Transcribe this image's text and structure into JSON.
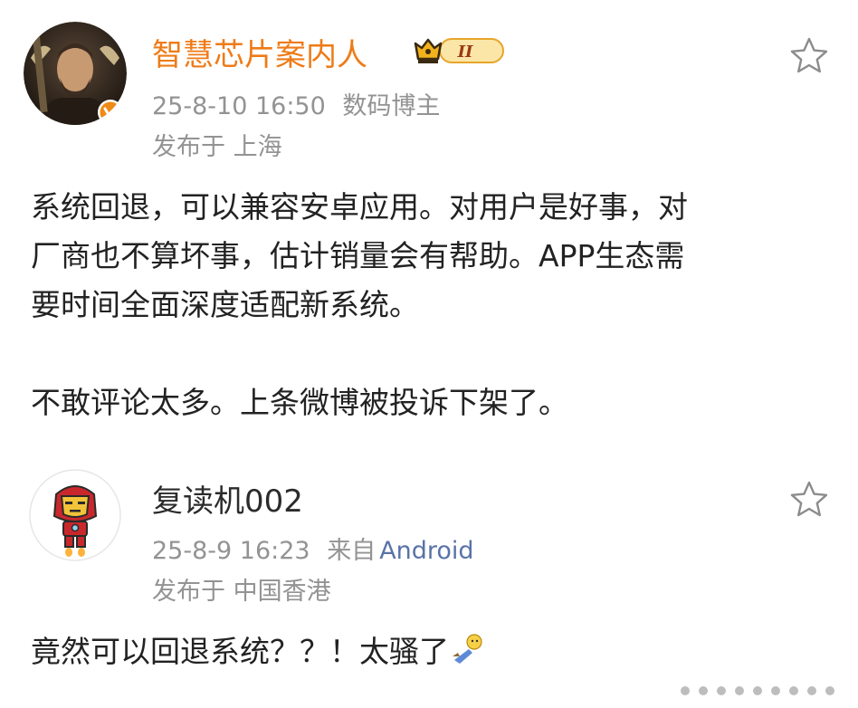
{
  "posts": [
    {
      "user_name": "智慧芯片案内人",
      "level_badge": "II",
      "time": "25-8-10 16:50",
      "tag": "数码博主",
      "location": "发布于 上海",
      "paragraphs": [
        "系统回退，可以兼容安卓应用。对用户是好事，对",
        "厂商也不算坏事，估计销量会有帮助。APP生态需",
        "要时间全面深度适配新系统。",
        "",
        "不敢评论太多。上条微博被投诉下架了。"
      ],
      "icons": [
        "portrait-avatar-icon",
        "verified-v-icon",
        "crown-level-icon",
        "star-icon"
      ]
    },
    {
      "user_name": "复读机002",
      "time": "25-8-9 16:23",
      "source_prefix": "来自",
      "source": "Android",
      "location": "发布于 中国香港",
      "text": "竟然可以回退系统？？！太骚了",
      "icons": [
        "ironman-avatar-icon",
        "star-icon",
        "flying-emoji-icon"
      ]
    }
  ],
  "colors": {
    "verified_name": "#ee7b17",
    "meta_gray": "#939393",
    "link_blue": "#5873a8",
    "badge_gold": "#f2b21c"
  }
}
